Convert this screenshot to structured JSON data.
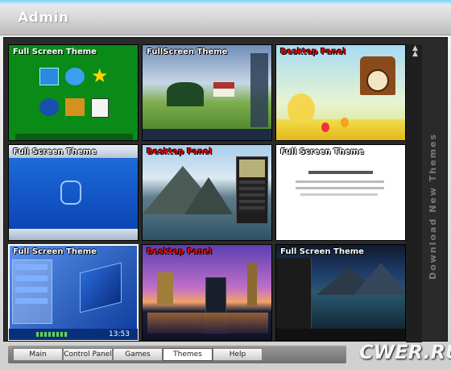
{
  "window": {
    "title": "Admin"
  },
  "themes": [
    {
      "caption": "Full Screen Theme",
      "style": "white"
    },
    {
      "caption": "FullScreen Theme",
      "style": "white"
    },
    {
      "caption": "Desktop Panel",
      "style": "red"
    },
    {
      "caption": "Full Screen Theme",
      "style": "white"
    },
    {
      "caption": "Desktop Panel",
      "style": "red"
    },
    {
      "caption": "Full Screen Theme",
      "style": "white"
    },
    {
      "caption": "Full Screen Theme",
      "style": "white"
    },
    {
      "caption": "Desktop Panel",
      "style": "red"
    },
    {
      "caption": "Full Screen Theme",
      "style": "white"
    }
  ],
  "thumb_text": {
    "clock": "13:53"
  },
  "sidebar": {
    "label": "Download New Themes",
    "scroll_up_icon": "double-chevron-up-icon",
    "scroll_down_icon": "double-chevron-down-icon"
  },
  "tabs": [
    {
      "label": "Main"
    },
    {
      "label": "Control Panel"
    },
    {
      "label": "Games"
    },
    {
      "label": "Themes"
    },
    {
      "label": "Help"
    }
  ],
  "active_tab": "Themes",
  "watermark": "CWER.RU",
  "colors": {
    "title_text": "#ffffff",
    "red_caption": "#e81010",
    "frame_bg": "#2a2a2a"
  }
}
